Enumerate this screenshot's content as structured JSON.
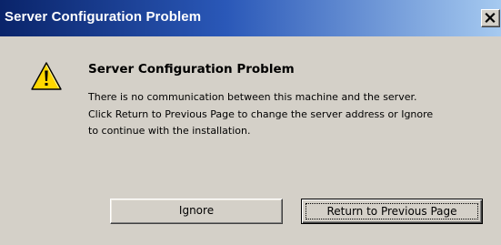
{
  "window": {
    "title": "Server Configuration Problem",
    "close_symbol": "×",
    "close_icon": "close-icon"
  },
  "dialog": {
    "icon": "warning-icon",
    "heading": "Server Configuration Problem",
    "message": "There is no communication between this machine and the server.\nClick Return to Previous Page to change the server address or Ignore\nto continue with the installation."
  },
  "buttons": {
    "ignore_label": "Ignore",
    "return_label": "Return to Previous Page",
    "default_button": "return"
  },
  "colors": {
    "titlebar_start": "#0a246a",
    "titlebar_end": "#a6caf0",
    "face": "#d4d0c8",
    "warning_fill": "#ffd800"
  }
}
